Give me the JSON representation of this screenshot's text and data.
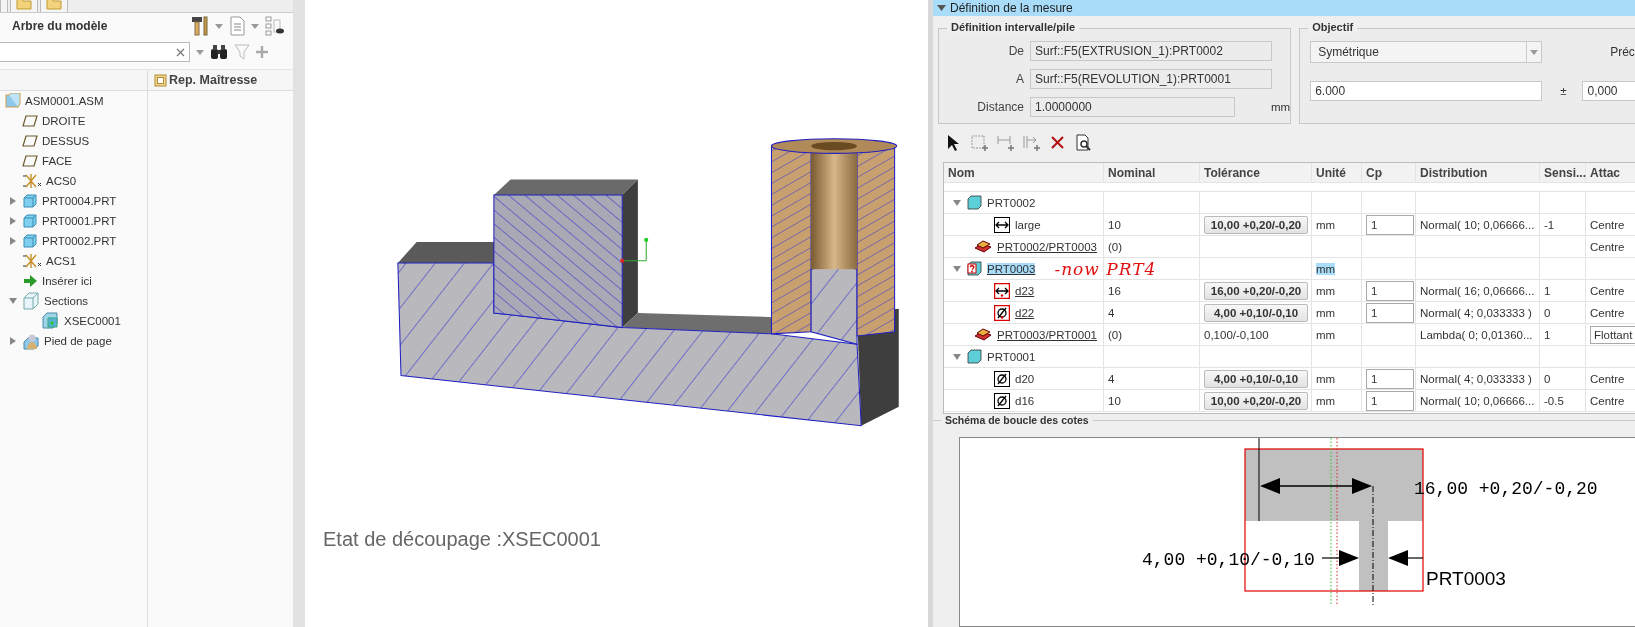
{
  "model_tree": {
    "title": "Arbre du modèle",
    "column": "Rep. Maîtresse",
    "items": [
      {
        "label": "ASM0001.ASM",
        "kind": "assembly",
        "children": [
          {
            "label": "DROITE",
            "kind": "plane"
          },
          {
            "label": "DESSUS",
            "kind": "plane"
          },
          {
            "label": "FACE",
            "kind": "plane"
          },
          {
            "label": "ACS0",
            "kind": "csys"
          },
          {
            "label": "PRT0004.PRT",
            "kind": "part",
            "expanded": false
          },
          {
            "label": "PRT0001.PRT",
            "kind": "part",
            "expanded": false
          },
          {
            "label": "PRT0002.PRT",
            "kind": "part",
            "expanded": false
          },
          {
            "label": "ACS1",
            "kind": "csys"
          },
          {
            "label": "Insérer ici",
            "kind": "insert"
          },
          {
            "label": "Sections",
            "kind": "sections",
            "expanded": true,
            "children": [
              {
                "label": "XSEC0001",
                "kind": "section"
              }
            ]
          },
          {
            "label": "Pied de page",
            "kind": "footer",
            "expanded": false
          }
        ]
      }
    ]
  },
  "viewport": {
    "status": "Etat de découpage :XSEC0001"
  },
  "measure_definition": {
    "title": "Définition de la mesure",
    "expanded": true,
    "interval": {
      "title": "Définition intervalle/pile",
      "fields": [
        {
          "label": "De",
          "value": "Surf::F5(EXTRUSION_1):PRT0002"
        },
        {
          "label": "A",
          "value": "Surf::F5(REVOLUTION_1):PRT0001"
        },
        {
          "label": "Distance",
          "value": "1.0000000",
          "unit": "mm"
        }
      ]
    },
    "objective": {
      "title": "Objectif",
      "mode": "Symétrique",
      "precision_label": "Préc",
      "target": "6.000",
      "plus_minus": "±",
      "tolerance": "0,000"
    }
  },
  "table": {
    "columns": [
      "Nom",
      "Nominal",
      "Tolérance",
      "Unité",
      "Cp",
      "Distribution",
      "Sensi...",
      "Attac"
    ],
    "rows": [
      {
        "kind": "part",
        "name": "PRT0002",
        "expanded": true,
        "selected": false,
        "flagged": false,
        "link": false,
        "children": [
          {
            "kind": "linear_dimension",
            "flagged": false,
            "name": "large",
            "link": false,
            "nominal": "10",
            "tolerance": "10,00 +0,20/-0,20",
            "unit": "mm",
            "cp": "1",
            "distribution": "Normal( 10; 0,06666...",
            "sensitivity": "-1",
            "attachment": "Centre",
            "attachment_field": false
          }
        ]
      },
      {
        "kind": "relation",
        "name": "PRT0002/PRT0003",
        "link": true,
        "nominal": "(0)",
        "attachment": "Centre",
        "attachment_field": false
      },
      {
        "kind": "part",
        "name": "PRT0003",
        "expanded": true,
        "selected": true,
        "flagged": true,
        "link": true,
        "unit": "mm",
        "note": "-now PRT4",
        "children": [
          {
            "kind": "linear_dimension",
            "flagged": true,
            "name": "d23",
            "link": true,
            "nominal": "16",
            "tolerance": "16,00 +0,20/-0,20",
            "unit": "mm",
            "cp": "1",
            "distribution": "Normal( 16; 0,06666...",
            "sensitivity": "1",
            "attachment": "Centre",
            "attachment_field": false
          },
          {
            "kind": "diameter_dimension",
            "flagged": true,
            "name": "d22",
            "link": true,
            "nominal": "4",
            "tolerance": "4,00 +0,10/-0,10",
            "unit": "mm",
            "cp": "1",
            "distribution": "Normal( 4; 0,033333 )",
            "sensitivity": "0",
            "attachment": "Centre",
            "attachment_field": false
          }
        ]
      },
      {
        "kind": "relation",
        "name": "PRT0003/PRT0001",
        "link": true,
        "nominal": "(0)",
        "tolerance": "0,100/-0,100",
        "unit": "mm",
        "distribution": "Lambda( 0; 0,01360...",
        "sensitivity": "1",
        "attachment": "Flottant",
        "attachment_field": true
      },
      {
        "kind": "part",
        "name": "PRT0001",
        "expanded": true,
        "selected": false,
        "flagged": false,
        "link": false,
        "children": [
          {
            "kind": "diameter_dimension",
            "flagged": false,
            "name": "d20",
            "link": false,
            "nominal": "4",
            "tolerance": "4,00 +0,10/-0,10",
            "unit": "mm",
            "cp": "1",
            "distribution": "Normal( 4; 0,033333 )",
            "sensitivity": "0",
            "attachment": "Centre",
            "attachment_field": false
          },
          {
            "kind": "diameter_dimension",
            "flagged": false,
            "name": "d16",
            "link": false,
            "nominal": "10",
            "tolerance": "10,00 +0,20/-0,20",
            "unit": "mm",
            "cp": "1",
            "distribution": "Normal( 10; 0,06666...",
            "sensitivity": "-0.5",
            "attachment": "Centre",
            "attachment_field": false
          }
        ]
      }
    ]
  },
  "loop_diagram": {
    "title": "Schéma de boucle des cotes",
    "outer_label": "16,00 +0,20/-0,20",
    "inner_label": "4,00 +0,10/-0,10",
    "part_label": "PRT0003"
  }
}
